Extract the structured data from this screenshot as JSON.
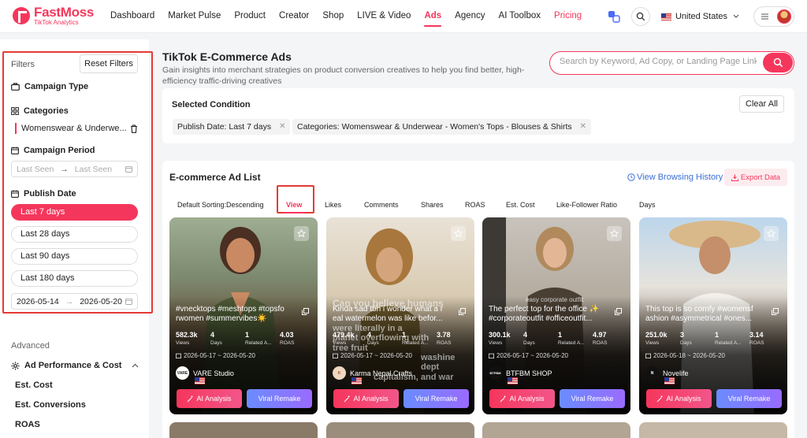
{
  "brand": {
    "name": "FastMoss",
    "tagline": "TikTok Analytics",
    "accent": "#f5365c"
  },
  "nav": {
    "items": [
      {
        "label": "Dashboard"
      },
      {
        "label": "Market Pulse"
      },
      {
        "label": "Product"
      },
      {
        "label": "Creator"
      },
      {
        "label": "Shop"
      },
      {
        "label": "LIVE & Video"
      },
      {
        "label": "Ads",
        "active": true
      },
      {
        "label": "Agency"
      },
      {
        "label": "AI Toolbox"
      },
      {
        "label": "Pricing"
      }
    ],
    "country": "United States"
  },
  "sidebar": {
    "filters_label": "Filters",
    "reset_label": "Reset Filters",
    "campaign_type": "Campaign Type",
    "categories_title": "Categories",
    "category_value": "Womenswear & Underwe...",
    "campaign_period": "Campaign Period",
    "period_start_placeholder": "Last Seen",
    "period_end_placeholder": "Last Seen",
    "publish_date": "Publish Date",
    "pills": [
      "Last 7 days",
      "Last 28 days",
      "Last 90 days",
      "Last 180 days"
    ],
    "date_from": "2026-05-14",
    "date_to": "2026-05-20",
    "advanced": "Advanced",
    "ad_perf": "Ad Performance & Cost",
    "adv_items": [
      "Est. Cost",
      "Est. Conversions",
      "ROAS"
    ]
  },
  "main": {
    "title": "TikTok E-Commerce Ads",
    "desc": "Gain insights into merchant strategies on product conversion creatives to help you find better, high-efficiency traffic-driving creatives",
    "search_placeholder": "Search by Keyword, Ad Copy, or Landing Page Link"
  },
  "condition": {
    "title": "Selected Condition",
    "clear": "Clear All",
    "chips": [
      "Publish Date: Last 7 days",
      "Categories: Womenswear & Underwear - Women's Tops - Blouses & Shirts"
    ]
  },
  "list": {
    "title": "E-commerce Ad List",
    "history": "View Browsing History",
    "export": "Export Data",
    "sorts": [
      "Default Sorting:Descending",
      "View",
      "Likes",
      "Comments",
      "Shares",
      "ROAS",
      "Est. Cost",
      "Like-Follower Ratio",
      "Days"
    ],
    "stat_labels": [
      "Views",
      "Days",
      "Related A...",
      "ROAS"
    ],
    "ai_label": "AI Analysis",
    "viral_label": "Viral Remake",
    "cards": [
      {
        "caption": "#vnecktops #meshtops #topsfo rwomen #summervibes☀️",
        "stats": [
          "582.3k",
          "4",
          "1",
          "4.03"
        ],
        "dates": "2026-05-17 ~ 2026-05-20",
        "shop": "VARE Studio",
        "shop_logo": "VARE"
      },
      {
        "caption": "Kinda sad tbh i wonder what a r eal watermelon was like befor...",
        "overlay": [
          "Can you believe humans",
          "were literally in a",
          "planet overflowing with",
          "tree fruit",
          "washine",
          "dept",
          "capitalism, and war"
        ],
        "stats": [
          "479.4k",
          "4",
          "1",
          "3.78"
        ],
        "dates": "2026-05-17 ~ 2026-05-20",
        "shop": "Karma Nepal Crafts",
        "shop_logo": "K"
      },
      {
        "caption": "The perfect top for the office ✨ #corporateoutfit #officeoutfit...",
        "overlay": [
          "easy corporate outfit:"
        ],
        "stats": [
          "300.1k",
          "4",
          "1",
          "4.97"
        ],
        "dates": "2026-05-17 ~ 2026-05-20",
        "shop": "BTFBM SHOP",
        "shop_logo": "BTFBM"
      },
      {
        "caption": "This top is so comfy #womensf ashion #asymmetrical #ones...",
        "stats": [
          "251.0k",
          "3",
          "1",
          "3.14"
        ],
        "dates": "2026-05-18 ~ 2026-05-20",
        "shop": "Novelife",
        "shop_logo": "N"
      }
    ]
  }
}
